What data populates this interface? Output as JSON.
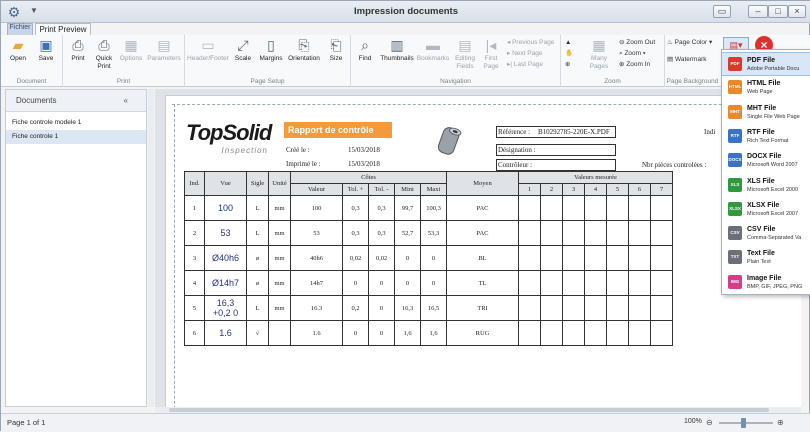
{
  "window": {
    "title": "Impression documents",
    "quick_access_label": "Print Preview",
    "tab_file": "Fichier",
    "buttons": {
      "minimize": "–",
      "maximize": "□",
      "close": "×",
      "restore": "▭"
    }
  },
  "ribbon": {
    "document": {
      "label": "Document",
      "open": "Open",
      "save": "Save"
    },
    "print": {
      "label": "Print",
      "print": "Print",
      "quick_print": "Quick Print",
      "options": "Options",
      "parameters": "Parameters"
    },
    "page_setup": {
      "label": "Page Setup",
      "header_footer": "Header/Footer",
      "scale": "Scale",
      "margins": "Margins",
      "orientation": "Orientation",
      "size": "Size"
    },
    "navigation": {
      "label": "Navigation",
      "find": "Find",
      "thumbnails": "Thumbnails",
      "bookmarks": "Bookmarks",
      "editing_fields": "Editing Fields",
      "first_page": "First Page",
      "previous_page": "Previous Page",
      "next_page": "Next Page",
      "last_page": "Last Page"
    },
    "zoom": {
      "label": "Zoom",
      "many_pages": "Many Pages",
      "zoom_out": "Zoom Out",
      "zoom": "Zoom",
      "zoom_in": "Zoom In"
    },
    "page_background": {
      "label": "Page Background",
      "page_color": "Page Color",
      "watermark": "Watermark"
    }
  },
  "documents_panel": {
    "title": "Documents",
    "items": [
      "Fiche controle modele 1",
      "Fiche controle 1"
    ],
    "selected_index": 1
  },
  "report": {
    "logo_main": "TopSolid",
    "logo_sub": "Inspection",
    "title": "Rapport de contrôle",
    "cree_le_label": "Créé le :",
    "cree_le": "15/03/2018",
    "imprime_le_label": "Imprimé le :",
    "imprime_le": "15/03/2018",
    "reference_label": "Référence :",
    "reference": "B10292785-220E-X.PDF",
    "indice_label": "Indi",
    "designation_label": "Désignation :",
    "controleur_label": "Contrôleur :",
    "nbr_pieces_label": "Nbr pièces controlées :",
    "columns": {
      "ind": "Ind.",
      "vue": "Vue",
      "sigle": "Sigle",
      "unite": "Unité",
      "cotes": "Côtes",
      "valeur": "Valeur",
      "tol_plus": "Tol. +",
      "tol_minus": "Tol. -",
      "mini": "Mini",
      "maxi": "Maxi",
      "moyen": "Moyen",
      "valeurs_mesurees": "Valeurs mesurée",
      "measure_nums": [
        "1",
        "2",
        "3",
        "4",
        "5",
        "6",
        "7"
      ]
    },
    "rows": [
      {
        "ind": "1",
        "vue": "100",
        "sigle": "L",
        "unite": "mm",
        "valeur": "100",
        "tol_plus": "0,3",
        "tol_minus": "0,3",
        "mini": "99,7",
        "maxi": "100,3",
        "moyen": "PAC"
      },
      {
        "ind": "2",
        "vue": "53",
        "sigle": "L",
        "unite": "mm",
        "valeur": "53",
        "tol_plus": "0,3",
        "tol_minus": "0,3",
        "mini": "52,7",
        "maxi": "53,3",
        "moyen": "PAC"
      },
      {
        "ind": "3",
        "vue": "Ø40h6",
        "sigle": "ø",
        "unite": "mm",
        "valeur": "40h6",
        "tol_plus": "0,02",
        "tol_minus": "0,02",
        "mini": "0",
        "maxi": "0",
        "moyen": "BL"
      },
      {
        "ind": "4",
        "vue": "Ø14h7",
        "sigle": "ø",
        "unite": "mm",
        "valeur": "14h7",
        "tol_plus": "0",
        "tol_minus": "0",
        "mini": "0",
        "maxi": "0",
        "moyen": "TL"
      },
      {
        "ind": "5",
        "vue": "16,3 +0,2 0",
        "sigle": "L",
        "unite": "mm",
        "valeur": "16.3",
        "tol_plus": "0,2",
        "tol_minus": "0",
        "mini": "16,3",
        "maxi": "16,5",
        "moyen": "TRI"
      },
      {
        "ind": "6",
        "vue": "1.6",
        "sigle": "√",
        "unite": "",
        "valeur": "1.6",
        "tol_plus": "0",
        "tol_minus": "0",
        "mini": "1,6",
        "maxi": "1,6",
        "moyen": "RUG"
      }
    ]
  },
  "export_menu": {
    "items": [
      {
        "name": "PDF File",
        "desc": "Adobe Portable Docu",
        "icon": "PDF",
        "color": "#d83b2b"
      },
      {
        "name": "HTML File",
        "desc": "Web Page",
        "icon": "HTML",
        "color": "#e8892a"
      },
      {
        "name": "MHT File",
        "desc": "Single File Web Page",
        "icon": "MHT",
        "color": "#e8892a"
      },
      {
        "name": "RTF File",
        "desc": "Rich Text Format",
        "icon": "RTF",
        "color": "#3b73c4"
      },
      {
        "name": "DOCX File",
        "desc": "Microsoft Word 2007",
        "icon": "DOCX",
        "color": "#3b73c4"
      },
      {
        "name": "XLS File",
        "desc": "Microsoft Excel 2000",
        "icon": "XLS",
        "color": "#2f9a3d"
      },
      {
        "name": "XLSX File",
        "desc": "Microsoft Excel 2007",
        "icon": "XLSX",
        "color": "#2f9a3d"
      },
      {
        "name": "CSV File",
        "desc": "Comma-Separated Va",
        "icon": "CSV",
        "color": "#6a6f78"
      },
      {
        "name": "Text File",
        "desc": "Plain Text",
        "icon": "TXT",
        "color": "#6a6f78"
      },
      {
        "name": "Image File",
        "desc": "BMP, GIF, JPEG, PNG",
        "icon": "IMG",
        "color": "#d83b8a"
      }
    ],
    "selected_index": 0
  },
  "status": {
    "page": "Page 1 of 1",
    "zoom": "100%"
  }
}
